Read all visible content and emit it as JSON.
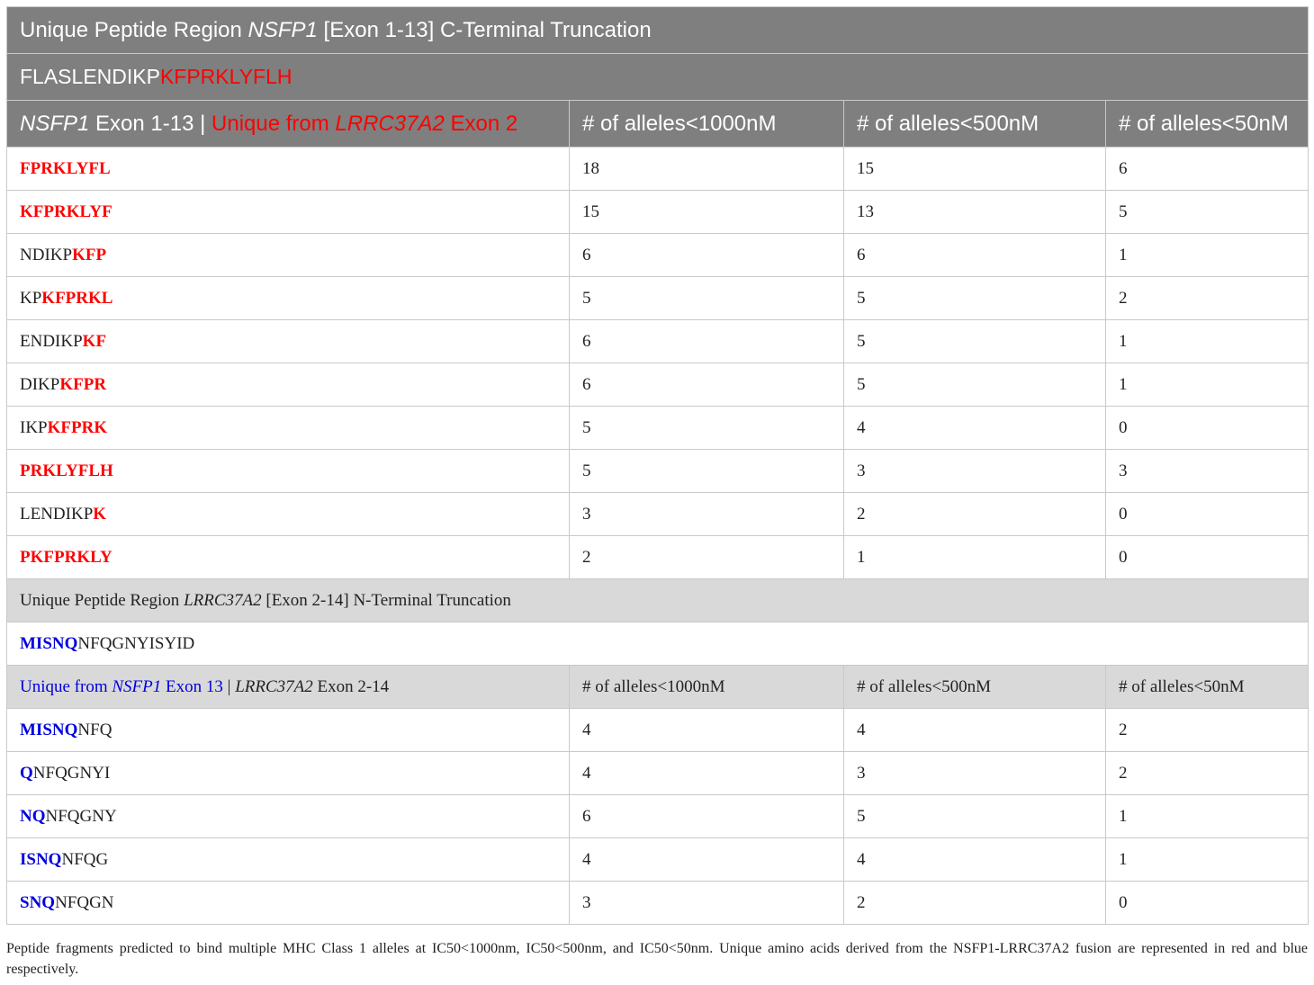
{
  "section1": {
    "title_prefix": "Unique Peptide Region ",
    "title_gene": "NSFP1",
    "title_suffix": " [Exon 1-13] C-Terminal Truncation",
    "sequence_black": "FLASLENDIKP",
    "sequence_red": "KFPRKLYFLH",
    "header": {
      "gene1": "NSFP1",
      "gene1_suffix": " Exon 1-13 | ",
      "unique_prefix": "Unique from ",
      "gene2": "LRRC37A2",
      "unique_suffix": " Exon 2",
      "col1": "# of alleles<1000nM",
      "col2": "# of alleles<500nM",
      "col3": "# of alleles<50nM"
    },
    "rows": [
      {
        "black": "",
        "red": "FPRKLYFL",
        "c1": "18",
        "c2": "15",
        "c3": "6"
      },
      {
        "black": "",
        "red": "KFPRKLYF",
        "c1": "15",
        "c2": "13",
        "c3": "5"
      },
      {
        "black": "NDIKP",
        "red": "KFP",
        "c1": "6",
        "c2": "6",
        "c3": "1"
      },
      {
        "black": "KP",
        "red": "KFPRKL",
        "c1": "5",
        "c2": "5",
        "c3": "2"
      },
      {
        "black": "ENDIKP",
        "red": "KF",
        "c1": "6",
        "c2": "5",
        "c3": "1"
      },
      {
        "black": "DIKP",
        "red": "KFPR",
        "c1": "6",
        "c2": "5",
        "c3": "1"
      },
      {
        "black": "IKP",
        "red": "KFPRK",
        "c1": "5",
        "c2": "4",
        "c3": "0"
      },
      {
        "black": "",
        "red": "PRKLYFLH",
        "c1": "5",
        "c2": "3",
        "c3": "3"
      },
      {
        "black": "LENDIKP",
        "red": "K",
        "c1": "3",
        "c2": "2",
        "c3": "0"
      },
      {
        "black": "",
        "red": "PKFPRKLY",
        "c1": "2",
        "c2": "1",
        "c3": "0"
      }
    ]
  },
  "section2": {
    "title_prefix": "Unique Peptide Region ",
    "title_gene": "LRRC37A2",
    "title_suffix": " [Exon 2-14] N-Terminal Truncation",
    "sequence_blue": "MISNQ",
    "sequence_black": "NFQGNYISYID",
    "header": {
      "unique_prefix": "Unique from ",
      "gene1": "NSFP1",
      "unique_suffix": " Exon 13",
      "separator": " | ",
      "gene2": "LRRC37A2",
      "gene2_suffix": " Exon 2-14",
      "col1": "# of alleles<1000nM",
      "col2": "# of alleles<500nM",
      "col3": "# of alleles<50nM"
    },
    "rows": [
      {
        "blue": "MISNQ",
        "black": "NFQ",
        "c1": "4",
        "c2": "4",
        "c3": "2"
      },
      {
        "blue": "Q",
        "black": "NFQGNYI",
        "c1": "4",
        "c2": "3",
        "c3": "2"
      },
      {
        "blue": "NQ",
        "black": "NFQGNY",
        "c1": "6",
        "c2": "5",
        "c3": "1"
      },
      {
        "blue": "ISNQ",
        "black": "NFQG",
        "c1": "4",
        "c2": "4",
        "c3": "1"
      },
      {
        "blue": "SNQ",
        "black": "NFQGN",
        "c1": "3",
        "c2": "2",
        "c3": "0"
      }
    ]
  },
  "caption": "Peptide fragments predicted to bind multiple MHC Class 1 alleles at IC50<1000nm, IC50<500nm, and IC50<50nm. Unique amino acids derived from the NSFP1-LRRC37A2 fusion are represented in red and blue respectively.",
  "colors": {
    "header_grey": "#7f7f7f",
    "light_grey": "#d9d9d9",
    "red": "#ff0000",
    "blue": "#0000dd"
  }
}
